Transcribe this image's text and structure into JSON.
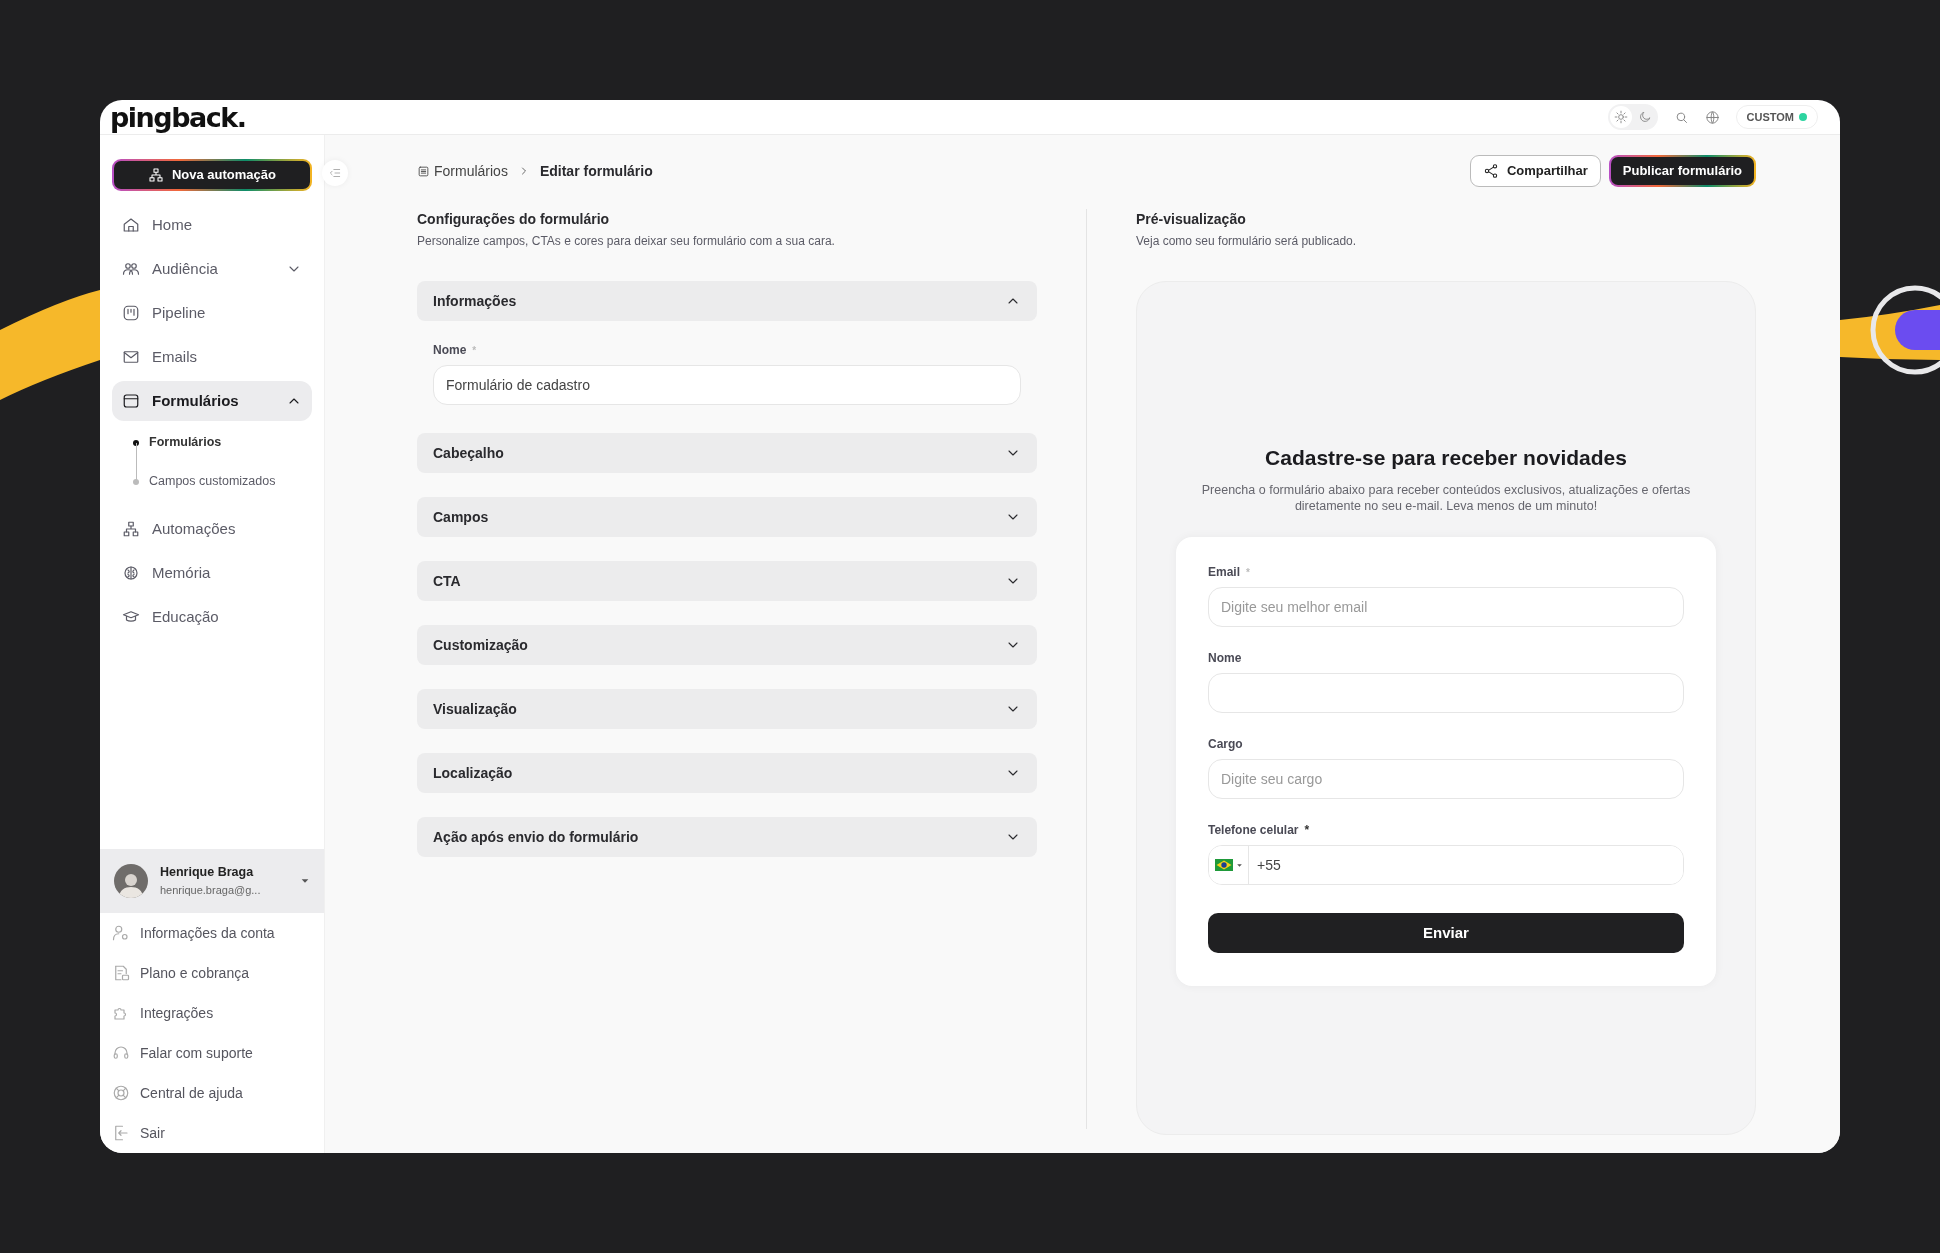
{
  "brand": {
    "logo": "pingback."
  },
  "topbar": {
    "theme": [
      {
        "kind": "light",
        "selected": true
      },
      {
        "kind": "dark",
        "selected": false
      }
    ],
    "plan_badge": {
      "label": "CUSTOM",
      "active": true
    }
  },
  "sidebar": {
    "new_button": "Nova automação",
    "items": [
      {
        "kind": "home",
        "label": "Home",
        "selected": false
      },
      {
        "kind": "audience",
        "label": "Audiência",
        "selected": false,
        "expanded": false
      },
      {
        "kind": "pipeline",
        "label": "Pipeline",
        "selected": false
      },
      {
        "kind": "email",
        "label": "Emails",
        "selected": false
      },
      {
        "kind": "forms",
        "label": "Formulários",
        "selected": true,
        "expanded": true,
        "children": [
          {
            "label": "Formulários",
            "selected": true
          },
          {
            "label": "Campos customizados",
            "selected": false
          }
        ]
      },
      {
        "kind": "automation",
        "label": "Automações",
        "selected": false
      },
      {
        "kind": "memory",
        "label": "Memória",
        "selected": false
      },
      {
        "kind": "education",
        "label": "Educação",
        "selected": false
      }
    ]
  },
  "user": {
    "name": "Henrique Braga",
    "email": "henrique.braga@g..."
  },
  "account_menu": [
    {
      "kind": "account",
      "label": "Informações da conta"
    },
    {
      "kind": "billing",
      "label": "Plano e cobrança"
    },
    {
      "kind": "integrations",
      "label": "Integrações"
    },
    {
      "kind": "support",
      "label": "Falar com suporte"
    },
    {
      "kind": "help",
      "label": "Central de ajuda"
    },
    {
      "kind": "logout",
      "label": "Sair"
    }
  ],
  "breadcrumb": [
    "Formulários",
    "Editar formulário"
  ],
  "actions": {
    "share": "Compartilhar",
    "publish": "Publicar formulário"
  },
  "settings": {
    "title": "Configurações do formulário",
    "subtitle": "Personalize campos, CTAs e cores para deixar seu formulário com a sua cara.",
    "sections": [
      {
        "label": "Informações",
        "expanded": true,
        "fields": [
          {
            "label": "Nome",
            "marker": "*",
            "marker_muted": true,
            "value": "Formulário de cadastro"
          }
        ]
      },
      {
        "label": "Cabeçalho",
        "expanded": false
      },
      {
        "label": "Campos",
        "expanded": false
      },
      {
        "label": "CTA",
        "expanded": false
      },
      {
        "label": "Customização",
        "expanded": false
      },
      {
        "label": "Visualização",
        "expanded": false
      },
      {
        "label": "Localização",
        "expanded": false
      },
      {
        "label": "Ação após envio do formulário",
        "expanded": false
      }
    ]
  },
  "preview": {
    "title": "Pré-visualização",
    "subtitle": "Veja como seu formulário será publicado.",
    "form": {
      "heading": "Cadastre-se para receber novidades",
      "description": "Preencha o formulário abaixo para receber conteúdos exclusivos, atualizações e ofertas diretamente no seu e-mail. Leva menos de um minuto!",
      "fields": [
        {
          "kind": "text",
          "label": "Email",
          "marker": "*",
          "marker_muted": true,
          "placeholder": "Digite seu melhor email"
        },
        {
          "kind": "text",
          "label": "Nome"
        },
        {
          "kind": "text",
          "label": "Cargo",
          "placeholder": "Digite seu cargo"
        },
        {
          "kind": "phone",
          "label": "Telefone celular",
          "marker": "*",
          "marker_muted": false,
          "value": "+55"
        }
      ],
      "submit": "Enviar"
    }
  }
}
